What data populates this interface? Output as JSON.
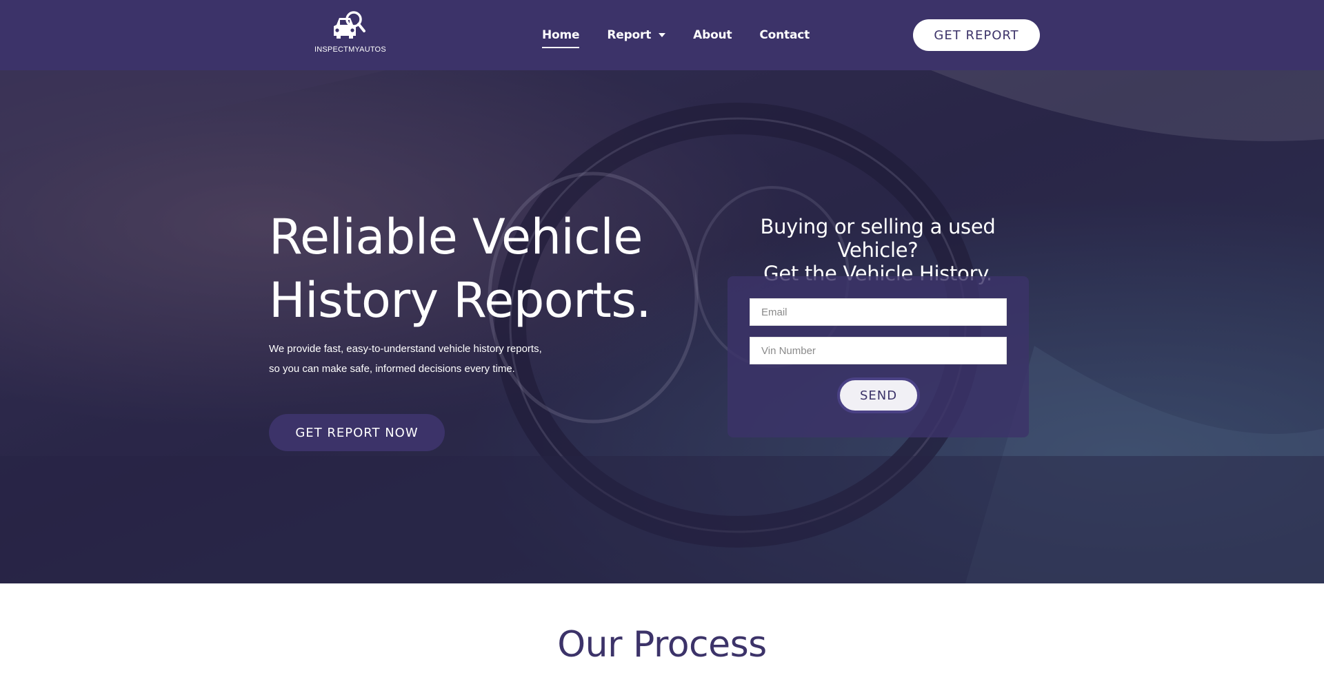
{
  "header": {
    "logo_text": "INSPECTMYAUTOS",
    "nav": [
      {
        "label": "Home",
        "active": true
      },
      {
        "label": "Report",
        "has_dropdown": true
      },
      {
        "label": "About"
      },
      {
        "label": "Contact"
      }
    ],
    "cta_label": "GET REPORT"
  },
  "hero": {
    "title_line1": "Reliable Vehicle",
    "title_line2": "History Reports.",
    "description_line1": "We provide fast, easy-to-understand vehicle history reports,",
    "description_line2": "so you can make safe, informed decisions every time.",
    "cta_label": "GET REPORT NOW"
  },
  "form": {
    "heading_line1": "Buying or selling a used Vehicle?",
    "heading_line2": "Get the Vehicle History.",
    "email_placeholder": "Email",
    "vin_placeholder": "Vin Number",
    "submit_label": "SEND"
  },
  "process": {
    "title": "Our Process"
  },
  "colors": {
    "brand": "#3c3369",
    "white": "#ffffff",
    "form_card": "#3c3369"
  },
  "icons": {
    "logo": "car-magnifier-icon",
    "report_dropdown": "caret-down-icon"
  }
}
